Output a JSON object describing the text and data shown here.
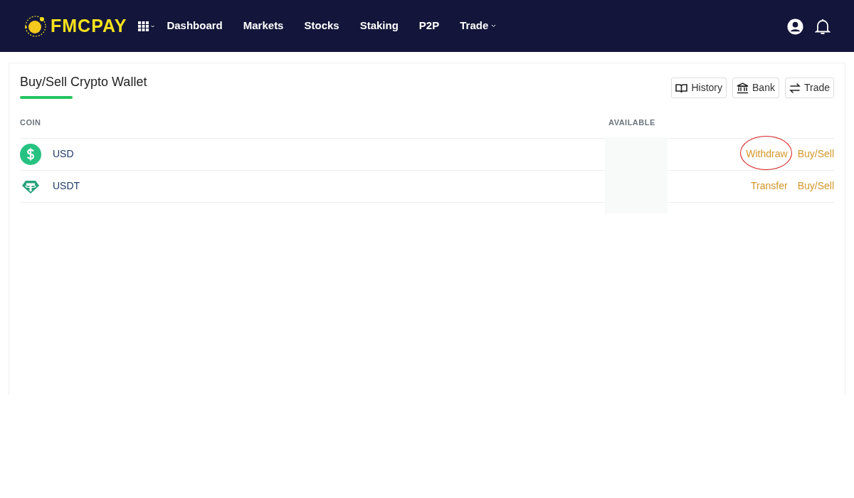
{
  "brand": {
    "name": "FMCPAY"
  },
  "nav": [
    {
      "label": "Dashboard",
      "dropdown": false
    },
    {
      "label": "Markets",
      "dropdown": false
    },
    {
      "label": "Stocks",
      "dropdown": false
    },
    {
      "label": "Staking",
      "dropdown": false
    },
    {
      "label": "P2P",
      "dropdown": false
    },
    {
      "label": "Trade",
      "dropdown": true
    }
  ],
  "wallet": {
    "title": "Buy/Sell Crypto Wallet",
    "buttons": [
      {
        "label": "History"
      },
      {
        "label": "Bank"
      },
      {
        "label": "Trade"
      }
    ],
    "columns": [
      "COIN",
      "AVAILABLE"
    ],
    "available_redacted": true,
    "rows": [
      {
        "coin": "USD",
        "actions": [
          {
            "label": "Withdraw",
            "circled": true
          },
          {
            "label": "Buy/Sell",
            "circled": false
          }
        ]
      },
      {
        "coin": "USDT",
        "actions": [
          {
            "label": "Transfer",
            "circled": false
          },
          {
            "label": "Buy/Sell",
            "circled": false
          }
        ]
      }
    ]
  }
}
